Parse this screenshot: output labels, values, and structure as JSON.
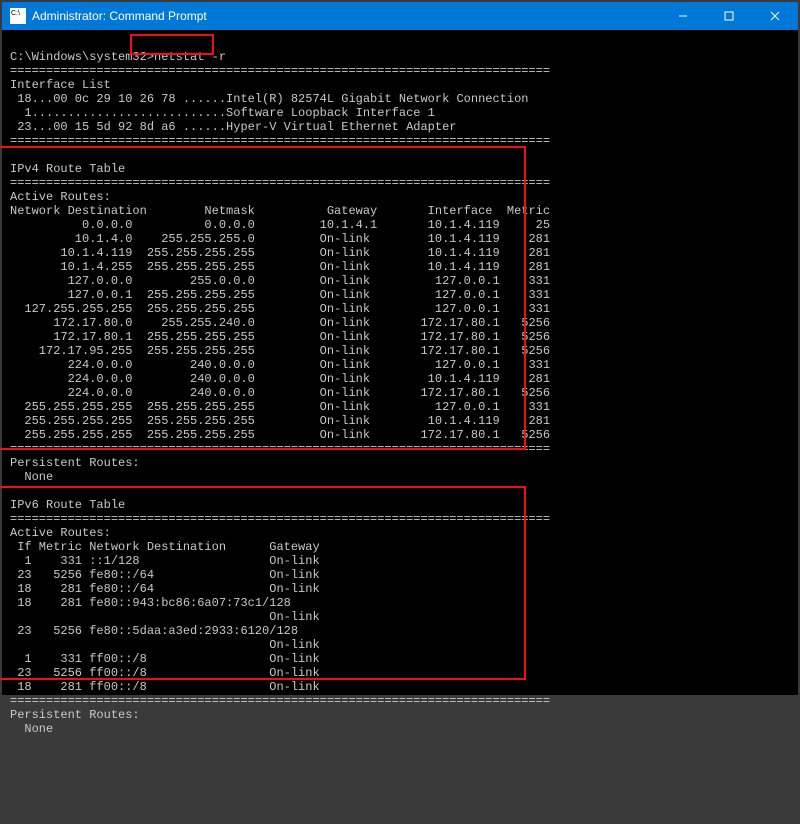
{
  "window_title": "Administrator: Command Prompt",
  "prompt": "C:\\Windows\\system32>",
  "command": "netstat -r",
  "divider_long": "===========================================================================",
  "interface_header": "Interface List",
  "interfaces": [
    " 18...00 0c 29 10 26 78 ......Intel(R) 82574L Gigabit Network Connection",
    "  1...........................Software Loopback Interface 1",
    " 23...00 15 5d 92 8d a6 ......Hyper-V Virtual Ethernet Adapter"
  ],
  "ipv4_title": "IPv4 Route Table",
  "active_routes_header": "Active Routes:",
  "ipv4_cols": "Network Destination        Netmask          Gateway       Interface  Metric",
  "ipv4_rows": [
    "          0.0.0.0          0.0.0.0         10.1.4.1       10.1.4.119     25",
    "         10.1.4.0    255.255.255.0         On-link        10.1.4.119    281",
    "       10.1.4.119  255.255.255.255         On-link        10.1.4.119    281",
    "       10.1.4.255  255.255.255.255         On-link        10.1.4.119    281",
    "        127.0.0.0        255.0.0.0         On-link         127.0.0.1    331",
    "        127.0.0.1  255.255.255.255         On-link         127.0.0.1    331",
    "  127.255.255.255  255.255.255.255         On-link         127.0.0.1    331",
    "      172.17.80.0    255.255.240.0         On-link       172.17.80.1   5256",
    "      172.17.80.1  255.255.255.255         On-link       172.17.80.1   5256",
    "    172.17.95.255  255.255.255.255         On-link       172.17.80.1   5256",
    "        224.0.0.0        240.0.0.0         On-link         127.0.0.1    331",
    "        224.0.0.0        240.0.0.0         On-link        10.1.4.119    281",
    "        224.0.0.0        240.0.0.0         On-link       172.17.80.1   5256",
    "  255.255.255.255  255.255.255.255         On-link         127.0.0.1    331",
    "  255.255.255.255  255.255.255.255         On-link        10.1.4.119    281",
    "  255.255.255.255  255.255.255.255         On-link       172.17.80.1   5256"
  ],
  "persistent_header": "Persistent Routes:",
  "persistent_none": "  None",
  "ipv6_title": "IPv6 Route Table",
  "ipv6_cols": " If Metric Network Destination      Gateway",
  "ipv6_rows": [
    "  1    331 ::1/128                  On-link",
    " 23   5256 fe80::/64                On-link",
    " 18    281 fe80::/64                On-link",
    " 18    281 fe80::943:bc86:6a07:73c1/128",
    "                                    On-link",
    " 23   5256 fe80::5daa:a3ed:2933:6120/128",
    "                                    On-link",
    "  1    331 ff00::/8                 On-link",
    " 23   5256 ff00::/8                 On-link",
    " 18    281 ff00::/8                 On-link"
  ]
}
